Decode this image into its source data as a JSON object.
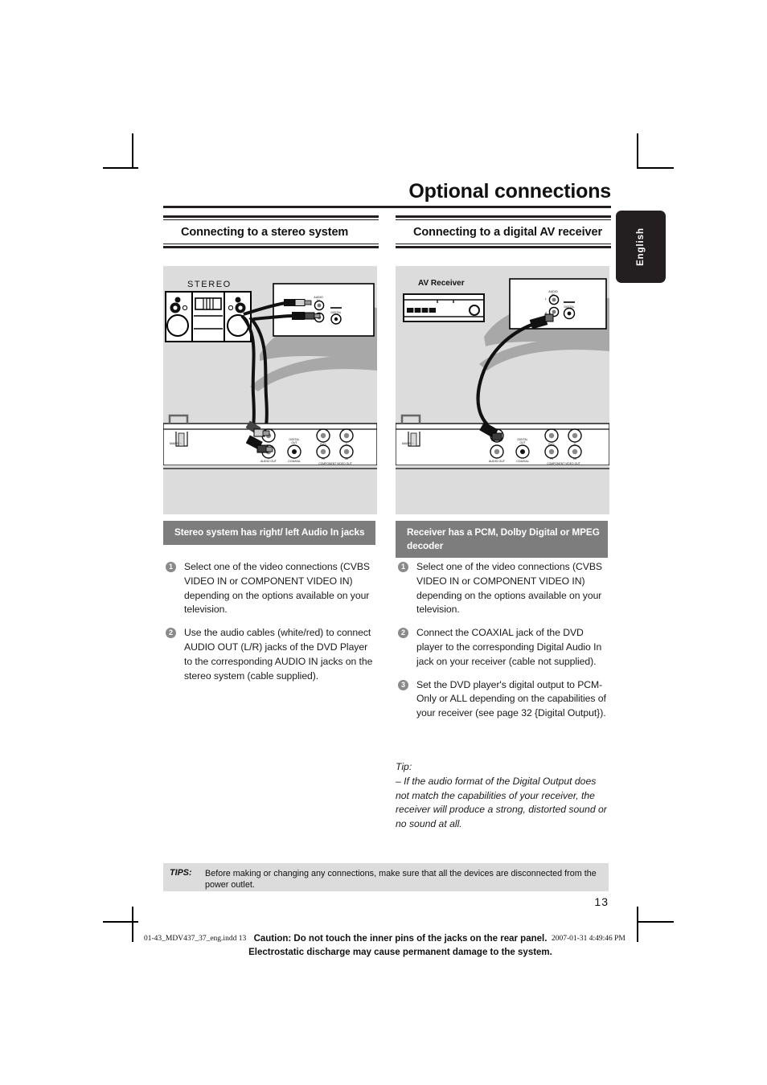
{
  "document": {
    "title": "Optional connections",
    "language_tab": "English",
    "page_number": "13"
  },
  "columns": [
    {
      "id": "stereo",
      "heading": "Connecting to a stereo system",
      "caption_bar": "Stereo system has right/ left Audio In jacks",
      "steps": [
        {
          "number": "1",
          "text": "Select one of the video connections (CVBS VIDEO IN or COMPONENT VIDEO IN) depending on the options available on your television."
        },
        {
          "number": "2",
          "text": "Use the audio cables (white/red) to connect AUDIO OUT (L/R) jacks of the DVD Player to the corresponding AUDIO IN jacks on the stereo system (cable supplied)."
        }
      ],
      "diagram": {
        "device_label": "STEREO",
        "tv_panel_labels": [
          "AUDIO IN",
          "L",
          "R",
          "DIGITAL"
        ],
        "player_panel_labels": [
          "AUDIO OUT",
          "DIGITAL OUT",
          "COAXIAL",
          "COMPONENT VIDEO OUT",
          "Pr/Cr",
          "Y",
          "Pb/Cb",
          "MAINS ~"
        ]
      }
    },
    {
      "id": "av-receiver",
      "heading": "Connecting to a digital AV receiver",
      "caption_bar": "Receiver has a PCM, Dolby Digital or MPEG decoder",
      "steps": [
        {
          "number": "1",
          "text": "Select one of the video connections (CVBS VIDEO IN or COMPONENT VIDEO IN) depending on the options available on your television."
        },
        {
          "number": "2",
          "text": "Connect the COAXIAL jack of the DVD player to the corresponding Digital Audio In jack on your receiver (cable not supplied)."
        },
        {
          "number": "3",
          "text": "Set the DVD player's digital output to PCM-Only or ALL depending on the capabilities of your receiver (see page 32 {Digital Output})."
        }
      ],
      "tip": {
        "label": "Tip:",
        "text": "– If the audio format of the Digital Output does not match the capabilities of your receiver, the receiver will produce a strong, distorted sound or no sound at all."
      },
      "diagram": {
        "device_label": "AV Receiver",
        "tv_panel_labels": [
          "AUDIO IN",
          "L",
          "R",
          "DIGITAL"
        ],
        "player_panel_labels": [
          "AUDIO OUT",
          "DIGITAL OUT",
          "COAXIAL",
          "COMPONENT VIDEO OUT",
          "Pr/Cr",
          "Y",
          "Pb/Cb",
          "MAINS ~"
        ]
      }
    }
  ],
  "tips_footer": {
    "label": "TIPS:",
    "text": "Before making or changing any connections, make sure that all the devices are disconnected from the power outlet."
  },
  "print_footer": {
    "file": "01-43_MDV437_37_eng.indd   13",
    "date": "2007-01-31   4:49:46 PM",
    "caution_line1": "Caution: Do not touch the inner pins of the jacks on the rear panel.",
    "caution_line2": "Electrostatic discharge may cause permanent damage to the system."
  },
  "colors": {
    "ink": "#231f20",
    "panel_grey": "#dcdcdc",
    "caption_grey": "#7d7d7d",
    "bullet_grey": "#8a8a8a"
  }
}
